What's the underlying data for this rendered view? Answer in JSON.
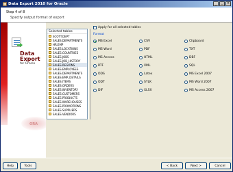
{
  "window": {
    "title": "Data Export 2010 for Oracle"
  },
  "header": {
    "step": "Step 4 of 8",
    "subtitle": "Specify output format of export"
  },
  "left": {
    "product_line1": "Data",
    "product_line2": "Export",
    "product_sub": "for Oracle",
    "watermark": "ORA"
  },
  "tables": {
    "header": "Selected tables",
    "items": [
      "SCOTT.DEPT",
      "SALES.DEPARTMENTS",
      "HR.EMP",
      "SALES.LOCATIONS",
      "SALES.COUNTRIES",
      "SALES.JOBS",
      "SALES.JOB_HISTORY",
      "SALES.REGIONS",
      "SALES.EMPLOYEES",
      "SALES.DEPARTMENTS",
      "SALES.EMP_DETAILS",
      "SALES.ITEMS",
      "SALES.ORDERS",
      "SALES.INVENTORY",
      "SALES.CUSTOMERS",
      "SALES.PRODUCTS",
      "SALES.WAREHOUSES",
      "SALES.PROMOTIONS",
      "SALES.SUPPLIERS",
      "SALES.VENDORS"
    ]
  },
  "options": {
    "apply_all_label": "Apply for all selected tables",
    "group_label": "Format",
    "formats": [
      "MS Excel",
      "CSV",
      "Clipboard",
      "MS Word",
      "PDF",
      "TXT",
      "MS Access",
      "HTML",
      "DBF",
      "RTF",
      "XML",
      "SQL",
      "ODS",
      "Latex",
      "MS Excel 2007",
      "ODT",
      "SYLK",
      "MS Word 2007",
      "DIF",
      "XLSX",
      "MS Access 2007"
    ],
    "selected": "MS Excel"
  },
  "footer": {
    "help": "Help",
    "tools": "Tools",
    "back": "< Back",
    "next": "Next >",
    "cancel": "Cancel"
  }
}
